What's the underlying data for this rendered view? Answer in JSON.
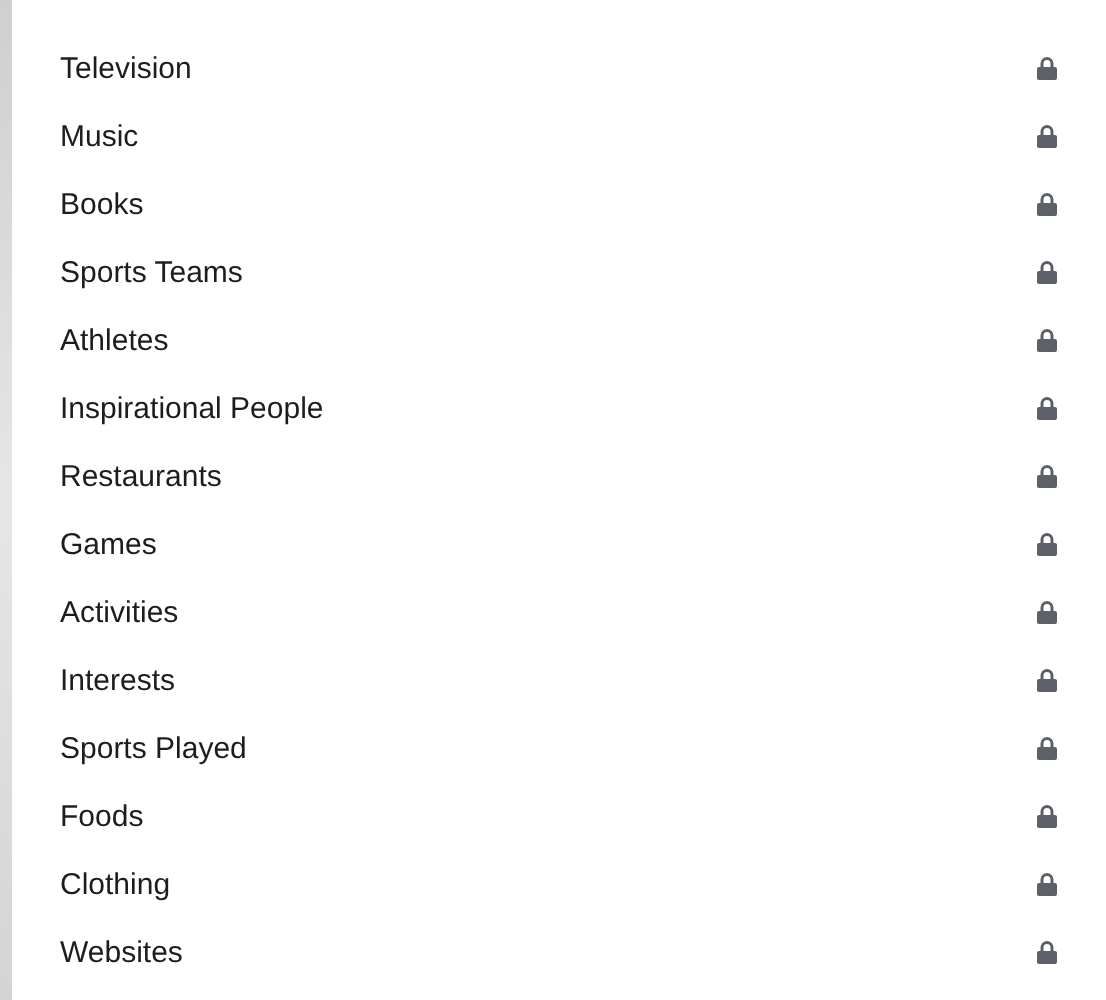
{
  "items": [
    {
      "label": "Television",
      "locked": true
    },
    {
      "label": "Music",
      "locked": true
    },
    {
      "label": "Books",
      "locked": true
    },
    {
      "label": "Sports Teams",
      "locked": true
    },
    {
      "label": "Athletes",
      "locked": true
    },
    {
      "label": "Inspirational People",
      "locked": true
    },
    {
      "label": "Restaurants",
      "locked": true
    },
    {
      "label": "Games",
      "locked": true
    },
    {
      "label": "Activities",
      "locked": true
    },
    {
      "label": "Interests",
      "locked": true
    },
    {
      "label": "Sports Played",
      "locked": true
    },
    {
      "label": "Foods",
      "locked": true
    },
    {
      "label": "Clothing",
      "locked": true
    },
    {
      "label": "Websites",
      "locked": true
    }
  ]
}
